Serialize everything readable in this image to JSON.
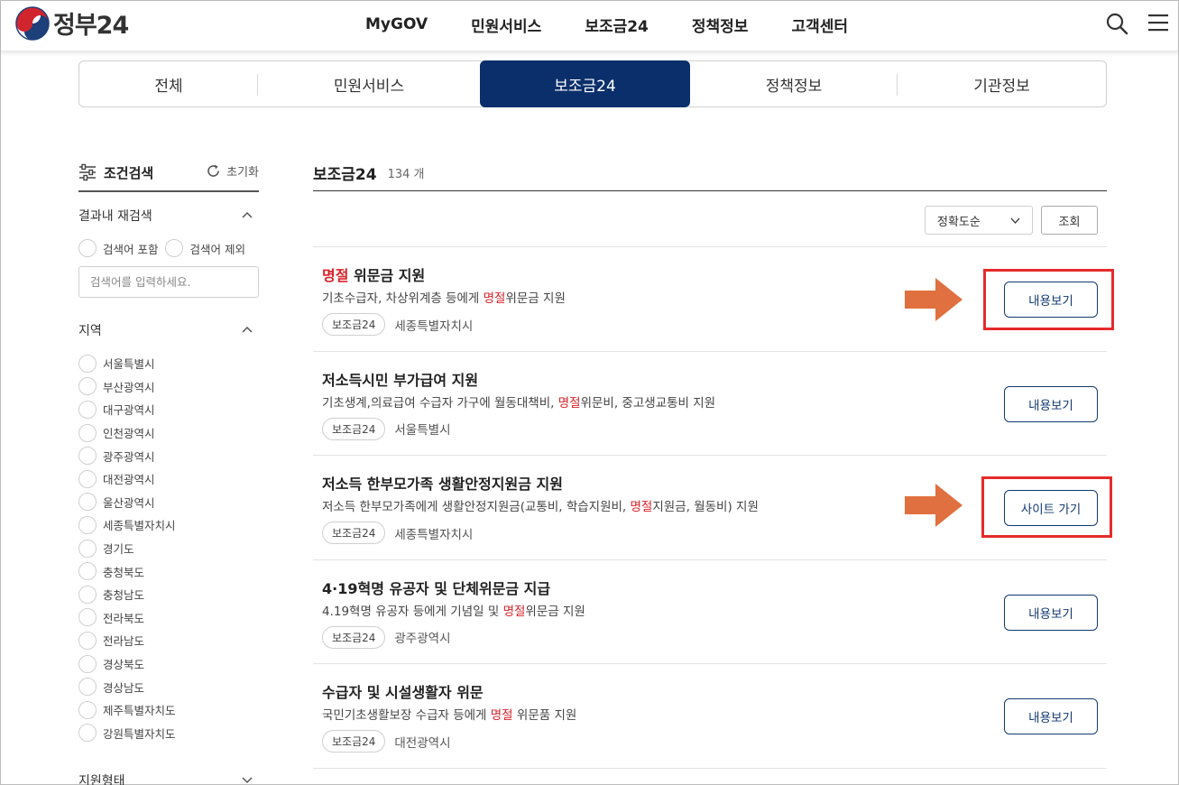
{
  "header": {
    "logo_text": "정부24",
    "nav": [
      "MyGOV",
      "민원서비스",
      "보조금24",
      "정책정보",
      "고객센터"
    ]
  },
  "tabs": [
    {
      "label": "전체",
      "active": false
    },
    {
      "label": "민원서비스",
      "active": false
    },
    {
      "label": "보조금24",
      "active": true
    },
    {
      "label": "정책정보",
      "active": false
    },
    {
      "label": "기관정보",
      "active": false
    }
  ],
  "sidebar": {
    "title": "조건검색",
    "reset_label": "초기화",
    "research": {
      "title": "결과내 재검색",
      "options": [
        "검색어 포함",
        "검색어 제외"
      ],
      "placeholder": "검색어를 입력하세요."
    },
    "region": {
      "title": "지역",
      "items": [
        "서울특별시",
        "부산광역시",
        "대구광역시",
        "인천광역시",
        "광주광역시",
        "대전광역시",
        "울산광역시",
        "세종특별자치시",
        "경기도",
        "충청북도",
        "충청남도",
        "전라북도",
        "전라남도",
        "경상북도",
        "경상남도",
        "제주특별자치도",
        "강원특별자치도"
      ]
    },
    "support_type": {
      "title": "지원형태"
    }
  },
  "main": {
    "title": "보조금24",
    "count": "134 개",
    "sort_label": "정확도순",
    "query_label": "조회",
    "highlight_color": "#d9222a",
    "items": [
      {
        "title_hl": "명절",
        "title_rest": " 위문금 지원",
        "desc_pre": "기초수급자, 차상위계층 등에게 ",
        "desc_hl": "명절",
        "desc_post": "위문금 지원",
        "tag": "보조금24",
        "org": "세종특별자치시",
        "button": "내용보기"
      },
      {
        "title_hl": "",
        "title_rest": "저소득시민 부가급여 지원",
        "desc_pre": "기초생계,의료급여 수급자 가구에 월동대책비, ",
        "desc_hl": "명절",
        "desc_post": "위문비, 중고생교통비 지원",
        "tag": "보조금24",
        "org": "서울특별시",
        "button": "내용보기"
      },
      {
        "title_hl": "",
        "title_rest": "저소득 한부모가족 생활안정지원금 지원",
        "desc_pre": "저소득 한부모가족에게 생활안정지원금(교통비, 학습지원비, ",
        "desc_hl": "명절",
        "desc_post": "지원금, 월동비) 지원",
        "tag": "보조금24",
        "org": "세종특별자치시",
        "button": "사이트 가기"
      },
      {
        "title_hl": "",
        "title_rest": "4·19혁명 유공자 및 단체위문금 지급",
        "desc_pre": "4.19혁명 유공자 등에게 기념일 및 ",
        "desc_hl": "명절",
        "desc_post": "위문금 지원",
        "tag": "보조금24",
        "org": "광주광역시",
        "button": "내용보기"
      },
      {
        "title_hl": "",
        "title_rest": "수급자 및 시설생활자 위문",
        "desc_pre": "국민기초생활보장 수급자 등에게 ",
        "desc_hl": "명절",
        "desc_post": " 위문품 지원",
        "tag": "보조금24",
        "org": "대전광역시",
        "button": "내용보기"
      }
    ]
  },
  "annotations": {
    "box_color": "#e52b2b",
    "arrow_color": "#e0703f"
  }
}
